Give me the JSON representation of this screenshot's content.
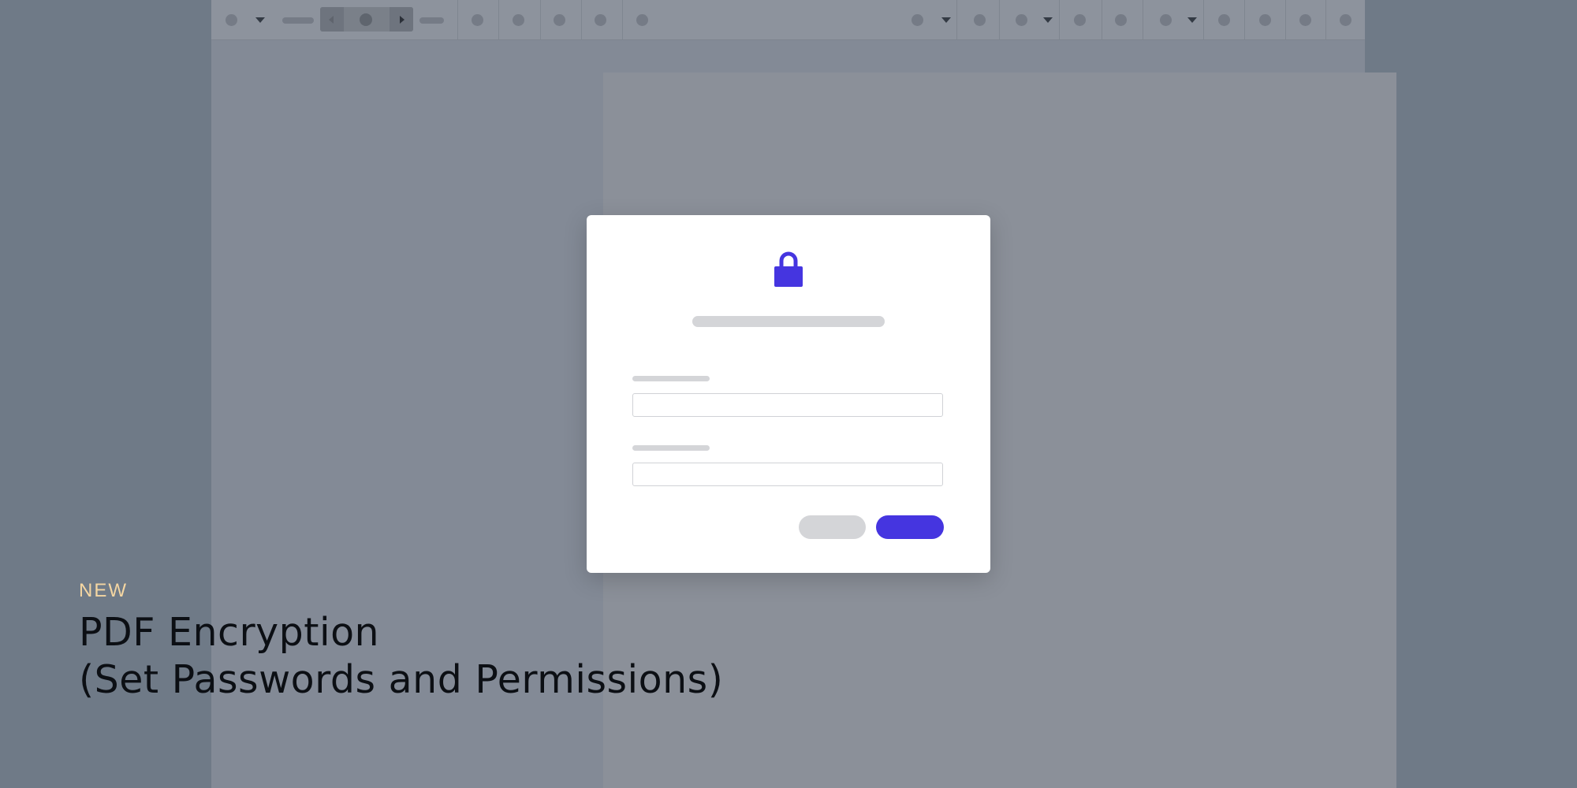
{
  "colors": {
    "backdrop": "#6f7a87",
    "accent": "#4535e0",
    "placeholder_gray": "#d4d5d8",
    "badge": "#f4d6a2",
    "heading": "#0c0f14"
  },
  "toolbar": {
    "icons": [
      "tool-icon",
      "tool-icon",
      "tool-icon",
      "tool-icon",
      "tool-icon",
      "tool-icon",
      "tool-icon",
      "tool-icon",
      "tool-icon",
      "tool-icon",
      "tool-icon",
      "tool-icon",
      "tool-icon",
      "tool-icon",
      "tool-icon",
      "tool-icon"
    ],
    "pager": {
      "prev_icon": "chevron-left-icon",
      "next_icon": "chevron-right-icon"
    }
  },
  "dialog": {
    "icon": "lock-icon",
    "fields": [
      {
        "value": "",
        "placeholder": ""
      },
      {
        "value": "",
        "placeholder": ""
      }
    ]
  },
  "caption": {
    "badge": "NEW",
    "title_line1": "PDF Encryption",
    "title_line2": "(Set Passwords and Permissions)"
  }
}
